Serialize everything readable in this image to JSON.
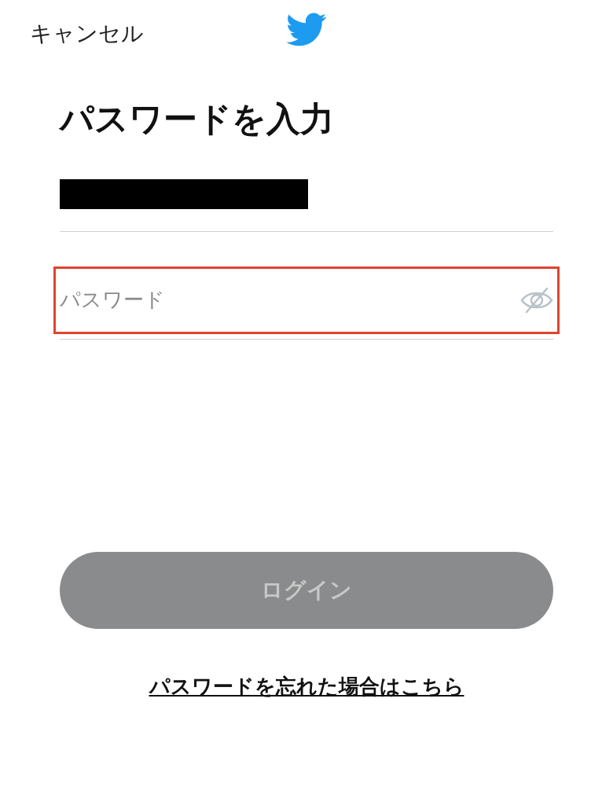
{
  "header": {
    "cancel": "キャンセル"
  },
  "title": "パスワードを入力",
  "username_field": {
    "redacted": true
  },
  "password_field": {
    "placeholder": "パスワード",
    "highlighted": true,
    "show_password": false
  },
  "login_button": {
    "label": "ログイン",
    "disabled": true
  },
  "forgot_link": "パスワードを忘れた場合はこちら"
}
